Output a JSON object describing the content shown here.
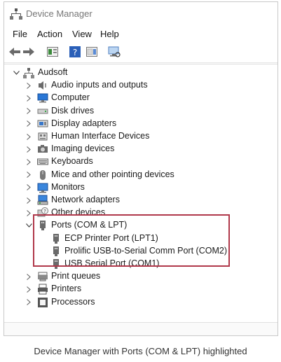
{
  "window": {
    "title": "Device Manager"
  },
  "menu": {
    "file": "File",
    "action": "Action",
    "view": "View",
    "help": "Help"
  },
  "toolbar": {
    "icons": [
      "back-arrow-icon",
      "forward-arrow-icon",
      "properties-icon",
      "help-icon",
      "show-hidden-icon",
      "monitor-scan-icon"
    ]
  },
  "tree": {
    "root": "Audsoft",
    "categories": [
      {
        "label": "Audio inputs and outputs",
        "icon": "speaker-icon"
      },
      {
        "label": "Computer",
        "icon": "computer-icon"
      },
      {
        "label": "Disk drives",
        "icon": "disk-drive-icon"
      },
      {
        "label": "Display adapters",
        "icon": "display-adapter-icon"
      },
      {
        "label": "Human Interface Devices",
        "icon": "hid-icon"
      },
      {
        "label": "Imaging devices",
        "icon": "camera-icon"
      },
      {
        "label": "Keyboards",
        "icon": "keyboard-icon"
      },
      {
        "label": "Mice and other pointing devices",
        "icon": "mouse-icon"
      },
      {
        "label": "Monitors",
        "icon": "monitor-icon"
      },
      {
        "label": "Network adapters",
        "icon": "network-adapter-icon"
      },
      {
        "label": "Other devices",
        "icon": "unknown-device-icon"
      },
      {
        "label": "Ports (COM & LPT)",
        "icon": "port-icon"
      },
      {
        "label": "Print queues",
        "icon": "print-queue-icon"
      },
      {
        "label": "Printers",
        "icon": "printer-icon"
      },
      {
        "label": "Processors",
        "icon": "processor-icon"
      }
    ],
    "ports_children": [
      "ECP Printer Port (LPT1)",
      "Prolific USB-to-Serial Comm Port (COM2)",
      "USB Serial Port (COM1)"
    ]
  },
  "caption": "Device Manager with Ports (COM & LPT) highlighted",
  "colors": {
    "highlight": "#b0384a",
    "accent": "#2a6fcf"
  }
}
